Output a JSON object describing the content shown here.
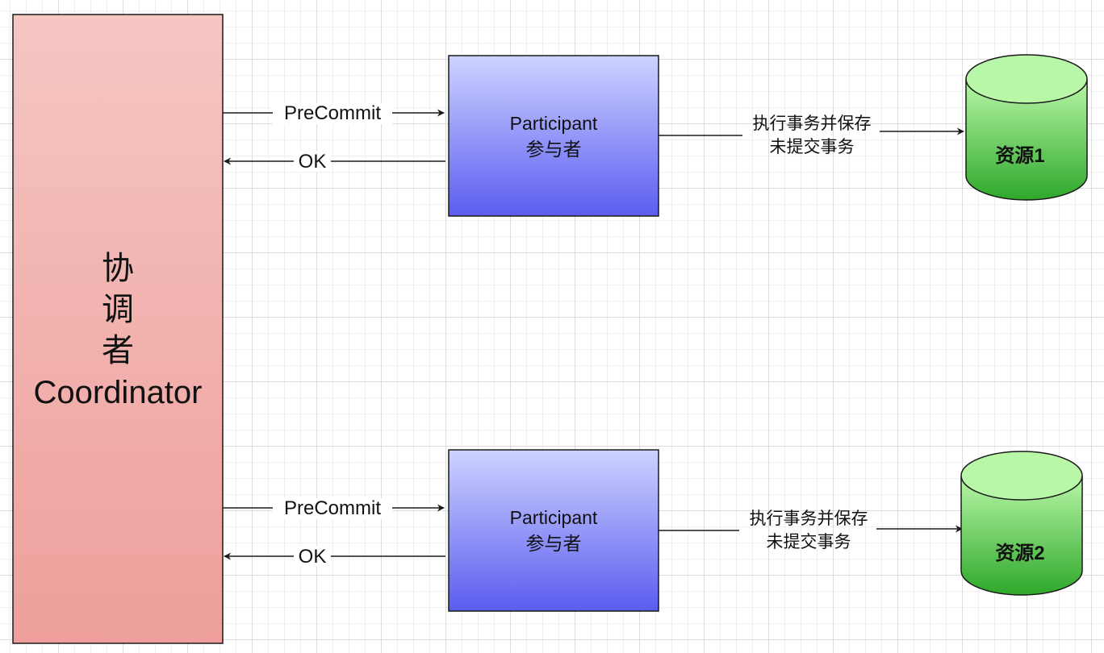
{
  "coordinator": {
    "label_lines": [
      "协",
      "调",
      "者",
      "Coordinator"
    ]
  },
  "flows": [
    {
      "precommit_label": "PreCommit",
      "ok_label": "OK",
      "participant": {
        "name": "Participant",
        "name_cn": "参与者"
      },
      "action_label_lines": [
        "执行事务并保存",
        "未提交事务"
      ],
      "resource": {
        "label": "资源1"
      }
    },
    {
      "precommit_label": "PreCommit",
      "ok_label": "OK",
      "participant": {
        "name": "Participant",
        "name_cn": "参与者"
      },
      "action_label_lines": [
        "执行事务并保存",
        "未提交事务"
      ],
      "resource": {
        "label": "资源2"
      }
    }
  ],
  "colors": {
    "coordinator_fill_top": "#f5c6c2",
    "coordinator_fill_bottom": "#ee9f9b",
    "participant_fill_top": "#cfd3ff",
    "participant_fill_bottom": "#5a5df0",
    "resource_fill_light": "#b9f7a8",
    "resource_fill_dark": "#2ea82a",
    "stroke": "#1a1a1a"
  }
}
